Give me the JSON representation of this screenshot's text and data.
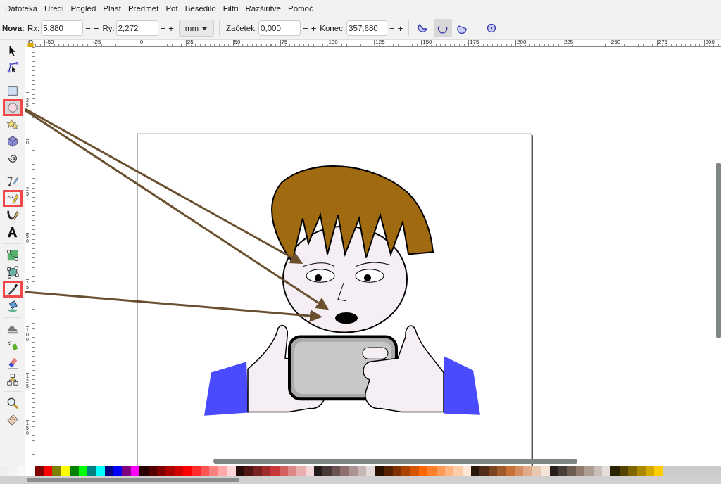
{
  "menu": [
    "Datoteka",
    "Uredi",
    "Pogled",
    "Plast",
    "Predmet",
    "Pot",
    "Besedilo",
    "Filtri",
    "Razširitve",
    "Pomoč"
  ],
  "toolbar": {
    "title": "Nova:",
    "fields": [
      {
        "label": "Rx:",
        "value": "5,880",
        "dec": "−",
        "inc": "+"
      },
      {
        "label": "Ry:",
        "value": "2,272",
        "dec": "−",
        "inc": "+"
      }
    ],
    "unit": "mm",
    "fields2": [
      {
        "label": "Začetek:",
        "value": "0,000",
        "dec": "−",
        "inc": "+"
      },
      {
        "label": "Konec:",
        "value": "357,680",
        "dec": "−",
        "inc": "+"
      }
    ],
    "arc_types": [
      {
        "kind": "slice",
        "selected": false
      },
      {
        "kind": "arc",
        "selected": true
      },
      {
        "kind": "chord",
        "selected": false
      }
    ]
  },
  "tools": [
    {
      "kind": "select",
      "selected": false,
      "highlighted": false
    },
    {
      "kind": "node",
      "selected": false,
      "highlighted": false
    },
    {
      "kind": "sep"
    },
    {
      "kind": "rect",
      "selected": false,
      "highlighted": false
    },
    {
      "kind": "ellipse",
      "selected": true,
      "highlighted": true
    },
    {
      "kind": "star",
      "selected": false,
      "highlighted": false
    },
    {
      "kind": "box3d",
      "selected": false,
      "highlighted": false
    },
    {
      "kind": "spiral",
      "selected": false,
      "highlighted": false
    },
    {
      "kind": "sep"
    },
    {
      "kind": "pen",
      "selected": false,
      "highlighted": false
    },
    {
      "kind": "pencil",
      "selected": false,
      "highlighted": true
    },
    {
      "kind": "calligraphy",
      "selected": false,
      "highlighted": false
    },
    {
      "kind": "text",
      "selected": false,
      "highlighted": false
    },
    {
      "kind": "sep"
    },
    {
      "kind": "gradient",
      "selected": false,
      "highlighted": false
    },
    {
      "kind": "mesh",
      "selected": false,
      "highlighted": false
    },
    {
      "kind": "dropper",
      "selected": false,
      "highlighted": true
    },
    {
      "kind": "bucket",
      "selected": false,
      "highlighted": false
    },
    {
      "kind": "sep"
    },
    {
      "kind": "tweak",
      "selected": false,
      "highlighted": false
    },
    {
      "kind": "spray",
      "selected": false,
      "highlighted": false
    },
    {
      "kind": "eraser",
      "selected": false,
      "highlighted": false
    },
    {
      "kind": "connector",
      "selected": false,
      "highlighted": false
    },
    {
      "kind": "sep"
    },
    {
      "kind": "zoom",
      "selected": false,
      "highlighted": false
    },
    {
      "kind": "measure",
      "selected": false,
      "highlighted": false
    }
  ],
  "rulers": {
    "horizontal": [
      "-50",
      "-25",
      "0",
      "25",
      "50",
      "75",
      "100",
      "125",
      "150",
      "175",
      "200",
      "225",
      "250",
      "275",
      "300"
    ],
    "vertical": [
      "-25",
      "0",
      "25",
      "50",
      "75",
      "100",
      "125",
      "150"
    ]
  },
  "palette": [
    {
      "color": "#eeeeee"
    },
    {
      "color": "#f3f3f3"
    },
    {
      "color": "#f8f8f8"
    },
    {
      "color": "#ffffff"
    },
    {
      "color": "#800000"
    },
    {
      "color": "#ff0000"
    },
    {
      "color": "#808000"
    },
    {
      "color": "#ffff00"
    },
    {
      "color": "#008000"
    },
    {
      "color": "#00ff00"
    },
    {
      "color": "#008080"
    },
    {
      "color": "#00ffff"
    },
    {
      "color": "#000080"
    },
    {
      "color": "#0000ff"
    },
    {
      "color": "#800080"
    },
    {
      "color": "#ff00ff"
    },
    {
      "color": "#2b0000"
    },
    {
      "color": "#550000"
    },
    {
      "color": "#800000"
    },
    {
      "color": "#aa0000"
    },
    {
      "color": "#d40000"
    },
    {
      "color": "#ff0000"
    },
    {
      "color": "#ff2a2a"
    },
    {
      "color": "#ff5555"
    },
    {
      "color": "#ff8080"
    },
    {
      "color": "#ffaaaa"
    },
    {
      "color": "#ffd5d5"
    },
    {
      "color": "#280b0b"
    },
    {
      "color": "#501616"
    },
    {
      "color": "#782121"
    },
    {
      "color": "#a02c2c"
    },
    {
      "color": "#c83737"
    },
    {
      "color": "#d35f5f"
    },
    {
      "color": "#de8787"
    },
    {
      "color": "#e9afaf"
    },
    {
      "color": "#f4d7d7"
    },
    {
      "color": "#241c1c"
    },
    {
      "color": "#483737"
    },
    {
      "color": "#6c5353"
    },
    {
      "color": "#916f6f"
    },
    {
      "color": "#ac9393"
    },
    {
      "color": "#c8b7b7"
    },
    {
      "color": "#e3dbdb"
    },
    {
      "color": "#2b1100"
    },
    {
      "color": "#552200"
    },
    {
      "color": "#803300"
    },
    {
      "color": "#aa4400"
    },
    {
      "color": "#d45500"
    },
    {
      "color": "#ff6600"
    },
    {
      "color": "#ff7f2a"
    },
    {
      "color": "#ff9955"
    },
    {
      "color": "#ffb380"
    },
    {
      "color": "#ffccaa"
    },
    {
      "color": "#ffe6d5"
    },
    {
      "color": "#28170b"
    },
    {
      "color": "#502d16"
    },
    {
      "color": "#784421"
    },
    {
      "color": "#a05a2c"
    },
    {
      "color": "#c87137"
    },
    {
      "color": "#d38d5f"
    },
    {
      "color": "#deaa87"
    },
    {
      "color": "#e9c6af"
    },
    {
      "color": "#f4e3d7"
    },
    {
      "color": "#241f1c"
    },
    {
      "color": "#483e37"
    },
    {
      "color": "#6c5d53"
    },
    {
      "color": "#917c6f"
    },
    {
      "color": "#ac9d93"
    },
    {
      "color": "#c8beb7"
    },
    {
      "color": "#e3dedb"
    },
    {
      "color": "#2b2200"
    },
    {
      "color": "#554400"
    },
    {
      "color": "#806600"
    },
    {
      "color": "#aa8800"
    },
    {
      "color": "#d4aa00"
    },
    {
      "color": "#ffcc00"
    }
  ]
}
